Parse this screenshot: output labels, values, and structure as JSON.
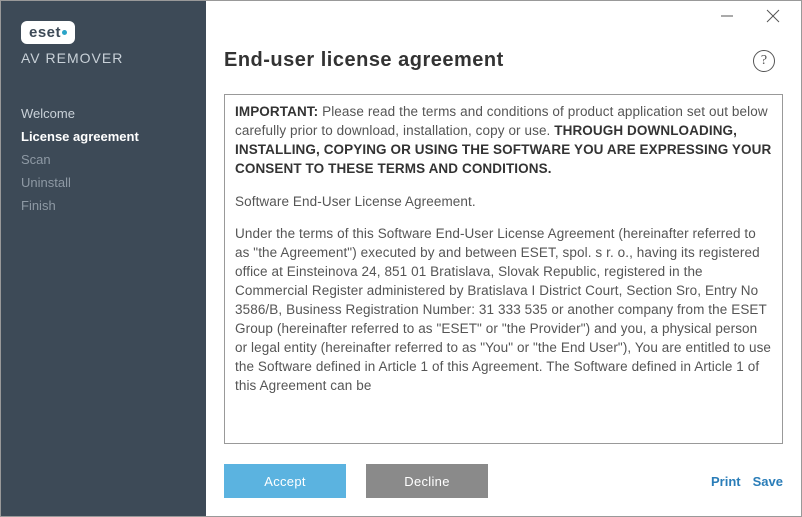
{
  "sidebar": {
    "logo_text": "eset",
    "subtitle": "AV REMOVER",
    "nav": [
      {
        "label": "Welcome",
        "state": "done"
      },
      {
        "label": "License agreement",
        "state": "active"
      },
      {
        "label": "Scan",
        "state": "pending"
      },
      {
        "label": "Uninstall",
        "state": "pending"
      },
      {
        "label": "Finish",
        "state": "pending"
      }
    ]
  },
  "header": {
    "title": "End-user license agreement"
  },
  "license": {
    "intro_label": "IMPORTANT:",
    "intro_text": " Please read the terms and conditions of product application set out below carefully prior to download, installation, copy or use. ",
    "caps_text": "THROUGH DOWNLOADING, INSTALLING, COPYING OR USING THE SOFTWARE YOU ARE EXPRESSING YOUR CONSENT TO THESE TERMS AND CONDITIONS.",
    "para2": "Software End-User License Agreement.",
    "para3": "Under the terms of this Software End-User License Agreement (hereinafter referred to as \"the Agreement\") executed by and between ESET, spol. s r. o., having its registered office at Einsteinova 24, 851 01 Bratislava, Slovak Republic, registered in the Commercial Register administered by Bratislava I District Court, Section Sro, Entry No 3586/B, Business Registration Number: 31 333 535 or another company from the ESET Group (hereinafter referred to as \"ESET\" or \"the Provider\") and you, a physical person or legal entity (hereinafter referred to as \"You\" or \"the End User\"), You are entitled to use the Software defined in Article 1 of this Agreement. The Software defined in Article 1 of this Agreement can be"
  },
  "footer": {
    "accept_label": "Accept",
    "decline_label": "Decline",
    "print_label": "Print",
    "save_label": "Save"
  }
}
